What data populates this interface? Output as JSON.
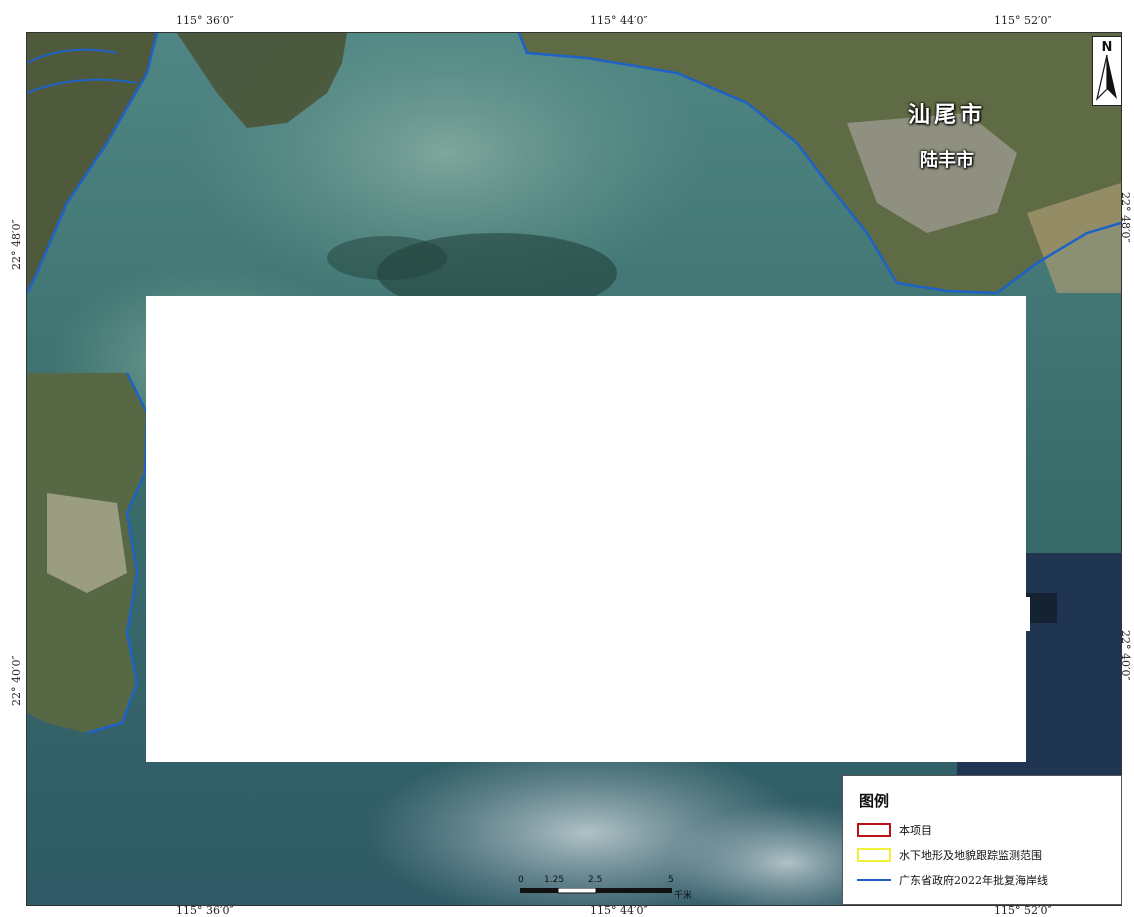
{
  "map": {
    "coords": {
      "top": [
        "115° 36′0″",
        "115° 44′0″",
        "115° 52′0″"
      ],
      "bottom": [
        "115° 36′0″",
        "115° 44′0″",
        "115° 52′0″"
      ],
      "left": [
        "22° 48′0″",
        "22° 40′0″"
      ],
      "right": [
        "22° 48′0″",
        "22° 40′0″"
      ]
    },
    "places": {
      "city": "汕尾市",
      "county": "陆丰市"
    },
    "north_label": "N",
    "legend": {
      "title": "图例",
      "items": [
        {
          "label": "本项目",
          "color": "#b8121a",
          "symbol": "box"
        },
        {
          "label": "水下地形及地貌跟踪监测范围",
          "color": "#f2ee3c",
          "symbol": "box"
        },
        {
          "label": "广东省政府2022年批复海岸线",
          "color": "#1e62c6",
          "symbol": "line"
        }
      ]
    },
    "scale": {
      "ticks": [
        "0",
        "1.25",
        "2.5",
        "5"
      ],
      "unit": "千米"
    },
    "colors": {
      "sea": "#3d6d6a",
      "land": "#5f6b45",
      "shoreline": "#1e62c6"
    }
  }
}
